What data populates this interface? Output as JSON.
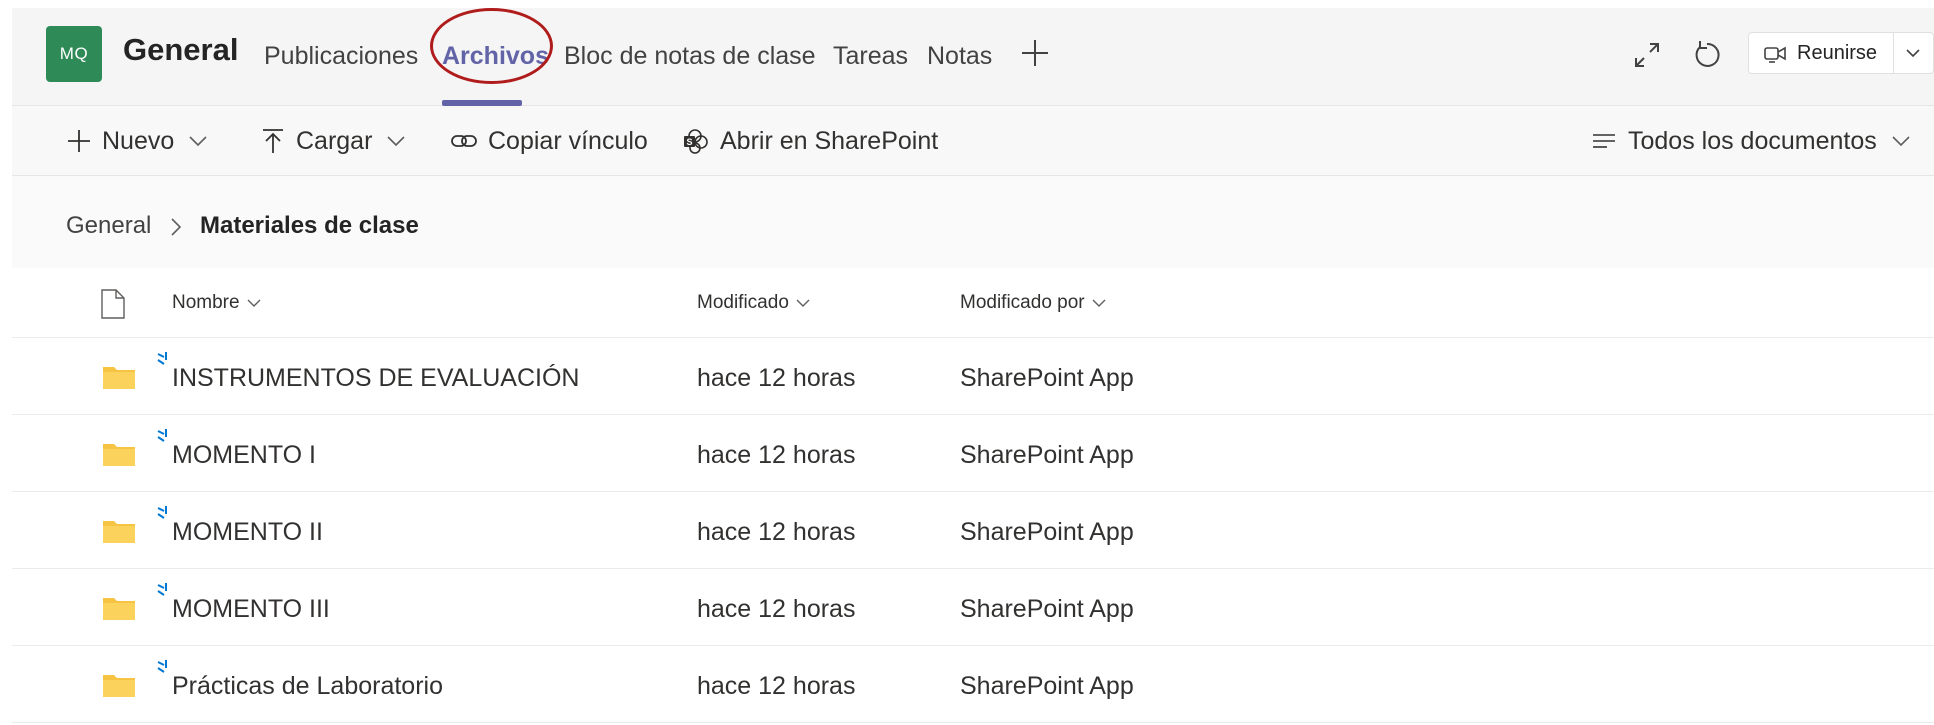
{
  "header": {
    "team_avatar": "MQ",
    "channel_name": "General",
    "tabs": [
      {
        "label": "Publicaciones"
      },
      {
        "label": "Archivos"
      },
      {
        "label": "Bloc de notas de clase"
      },
      {
        "label": "Tareas"
      },
      {
        "label": "Notas"
      }
    ],
    "active_tab": "Archivos",
    "meet_label": "Reunirse",
    "accent_color": "#6264a7",
    "annotation_color": "#b01c1c"
  },
  "toolbar": {
    "new_label": "Nuevo",
    "upload_label": "Cargar",
    "copy_link_label": "Copiar vínculo",
    "open_sharepoint_label": "Abrir en SharePoint",
    "view_label": "Todos los documentos"
  },
  "breadcrumb": {
    "root": "General",
    "current": "Materiales de clase"
  },
  "list": {
    "columns": {
      "name": "Nombre",
      "modified": "Modificado",
      "modified_by": "Modificado por"
    },
    "rows": [
      {
        "name": "INSTRUMENTOS DE EVALUACIÓN",
        "modified": "hace 12 horas",
        "modified_by": "SharePoint App"
      },
      {
        "name": "MOMENTO I",
        "modified": "hace 12 horas",
        "modified_by": "SharePoint App"
      },
      {
        "name": "MOMENTO II",
        "modified": "hace 12 horas",
        "modified_by": "SharePoint App"
      },
      {
        "name": "MOMENTO III",
        "modified": "hace 12 horas",
        "modified_by": "SharePoint App"
      },
      {
        "name": "Prácticas de Laboratorio",
        "modified": "hace 12 horas",
        "modified_by": "SharePoint App"
      }
    ],
    "folder_color": "#f6c342"
  }
}
